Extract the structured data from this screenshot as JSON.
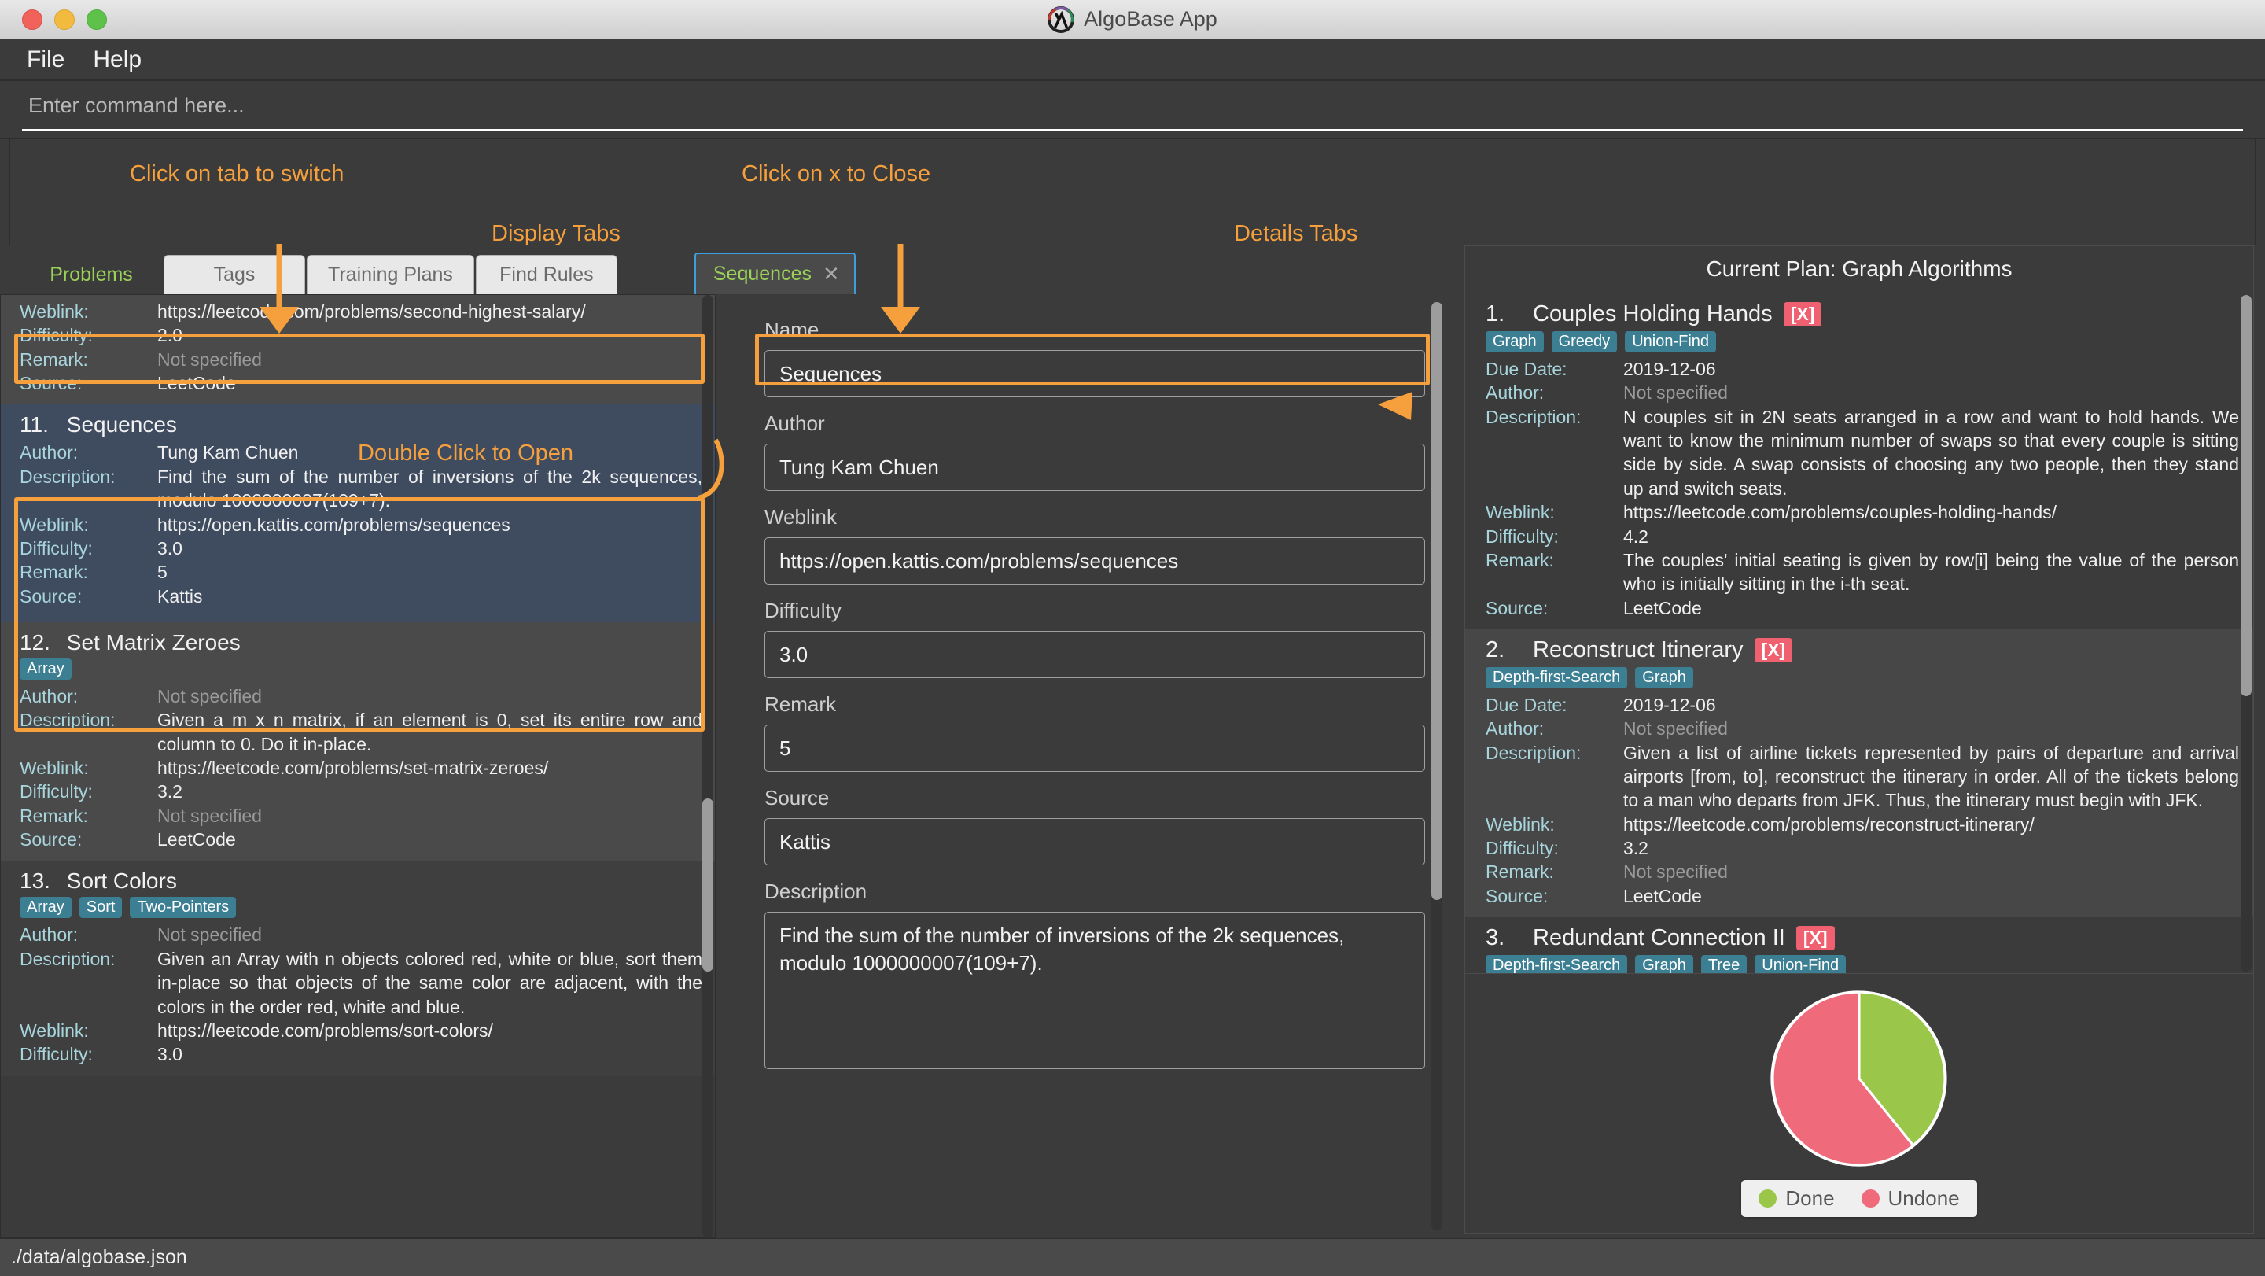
{
  "window": {
    "title": "AlgoBase App",
    "logo_icon": "lambda-circle-icon",
    "traffic_lights": [
      "close",
      "minimize",
      "zoom"
    ]
  },
  "menubar": {
    "items": [
      "File",
      "Help"
    ]
  },
  "command": {
    "placeholder": "Enter command here...",
    "value": ""
  },
  "annotations": [
    {
      "id": "click-tab-switch",
      "text": "Click on tab to switch"
    },
    {
      "id": "click-x-close",
      "text": "Click on x to Close"
    },
    {
      "id": "display-tabs",
      "text": "Display Tabs"
    },
    {
      "id": "details-tabs",
      "text": "Details Tabs"
    },
    {
      "id": "double-click-open",
      "text": "Double Click to Open"
    }
  ],
  "display_tabs": {
    "tabs": [
      {
        "label": "Problems",
        "active": true
      },
      {
        "label": "Tags",
        "active": false
      },
      {
        "label": "Training Plans",
        "active": false
      },
      {
        "label": "Find Rules",
        "active": false
      }
    ]
  },
  "details_tabs": {
    "tabs": [
      {
        "label": "Sequences",
        "close_icon": "close-x-icon",
        "close_label": "✕",
        "active": true
      }
    ]
  },
  "problem_list": {
    "labels": {
      "author": "Author:",
      "description": "Description:",
      "weblink": "Weblink:",
      "difficulty": "Difficulty:",
      "remark": "Remark:",
      "source": "Source:"
    },
    "items": [
      {
        "num": "10.",
        "name": "",
        "tags": [],
        "author": "",
        "description": "",
        "weblink": "https://leetcode.com/problems/second-highest-salary/",
        "difficulty": "2.0",
        "remark": "Not specified",
        "remark_muted": true,
        "source": "LeetCode",
        "selected": false,
        "partial_top": true
      },
      {
        "num": "11.",
        "name": "Sequences",
        "tags": [],
        "author": "Tung Kam Chuen",
        "description": "Find the sum of the number of inversions of the 2k sequences, modulo 1000000007(109+7).",
        "weblink": "https://open.kattis.com/problems/sequences",
        "difficulty": "3.0",
        "remark": "5",
        "remark_muted": false,
        "source": "Kattis",
        "selected": true
      },
      {
        "num": "12.",
        "name": "Set Matrix Zeroes",
        "tags": [
          "Array"
        ],
        "author": "Not specified",
        "author_muted": true,
        "description": "Given a m x n matrix, if an element is 0, set its entire row and column to 0. Do it in-place.",
        "weblink": "https://leetcode.com/problems/set-matrix-zeroes/",
        "difficulty": "3.2",
        "remark": "Not specified",
        "remark_muted": true,
        "source": "LeetCode",
        "selected": false
      },
      {
        "num": "13.",
        "name": "Sort Colors",
        "tags": [
          "Array",
          "Sort",
          "Two-Pointers"
        ],
        "author": "Not specified",
        "author_muted": true,
        "description": "Given an Array with n objects colored red, white or blue, sort them in-place so that objects of the same color are adjacent, with the colors in the order red, white and blue.",
        "weblink": "https://leetcode.com/problems/sort-colors/",
        "difficulty": "3.0",
        "remark": "",
        "source": "",
        "selected": false
      }
    ]
  },
  "details_form": {
    "fields": [
      {
        "label": "Name",
        "value": "Sequences",
        "type": "input"
      },
      {
        "label": "Author",
        "value": "Tung Kam Chuen",
        "type": "input"
      },
      {
        "label": "Weblink",
        "value": "https://open.kattis.com/problems/sequences",
        "type": "input"
      },
      {
        "label": "Difficulty",
        "value": "3.0",
        "type": "input"
      },
      {
        "label": "Remark",
        "value": "5",
        "type": "input"
      },
      {
        "label": "Source",
        "value": "Kattis",
        "type": "input"
      },
      {
        "label": "Description",
        "value": "Find the sum of the number of inversions of the 2k sequences, modulo 1000000007(109+7).",
        "type": "textarea"
      }
    ]
  },
  "plan_panel": {
    "title": "Current Plan: Graph Algorithms",
    "labels": {
      "due_date": "Due Date:",
      "author": "Author:",
      "description": "Description:",
      "weblink": "Weblink:",
      "difficulty": "Difficulty:",
      "remark": "Remark:",
      "source": "Source:"
    },
    "items": [
      {
        "num": "1.",
        "name": "Couples Holding Hands",
        "status_badge": "[X]",
        "tags": [
          "Graph",
          "Greedy",
          "Union-Find"
        ],
        "due_date": "2019-12-06",
        "author": "Not specified",
        "author_muted": true,
        "description": "N couples sit in 2N seats arranged in a row and want to hold hands. We want to know the minimum number of swaps so that every couple is sitting side by side. A swap consists of choosing any two people, then they stand up and switch seats.",
        "weblink": "https://leetcode.com/problems/couples-holding-hands/",
        "difficulty": "4.2",
        "remark": "The couples' initial seating is given by row[i] being the value of the person who is initially sitting in the i-th seat.",
        "source": "LeetCode"
      },
      {
        "num": "2.",
        "name": "Reconstruct Itinerary",
        "status_badge": "[X]",
        "tags": [
          "Depth-first-Search",
          "Graph"
        ],
        "due_date": "2019-12-06",
        "author": "Not specified",
        "author_muted": true,
        "description": "Given a list of airline tickets represented by pairs of departure and arrival airports [from, to], reconstruct the itinerary in order. All of the tickets belong to a man who departs from JFK. Thus, the itinerary must begin with JFK.",
        "weblink": "https://leetcode.com/problems/reconstruct-itinerary/",
        "difficulty": "3.2",
        "remark": "Not specified",
        "remark_muted": true,
        "source": "LeetCode"
      },
      {
        "num": "3.",
        "name": "Redundant Connection II",
        "status_badge": "[X]",
        "tags": [
          "Depth-first-Search",
          "Graph",
          "Tree",
          "Union-Find"
        ],
        "clipped": true
      }
    ]
  },
  "chart_data": {
    "type": "pie",
    "title": "",
    "labels": [
      "Done",
      "Undone"
    ],
    "values": [
      40,
      60
    ],
    "colors": [
      "#9ac64a",
      "#ef6b7c"
    ],
    "legend_position": "bottom",
    "legend_entries": [
      {
        "label": "Done",
        "color": "#9ac64a"
      },
      {
        "label": "Undone",
        "color": "#ef6b7c"
      }
    ]
  },
  "statusbar": {
    "path": "./data/algobase.json"
  },
  "colors": {
    "accent_orange": "#f5a03c",
    "tab_active_green": "#9cd159",
    "tag_teal": "#3c7f93",
    "badge_red": "#ef6070",
    "label_blue": "#a8d4dc",
    "selection_blue": "#3f4c60",
    "tab_focus_blue": "#3a9fdc"
  }
}
